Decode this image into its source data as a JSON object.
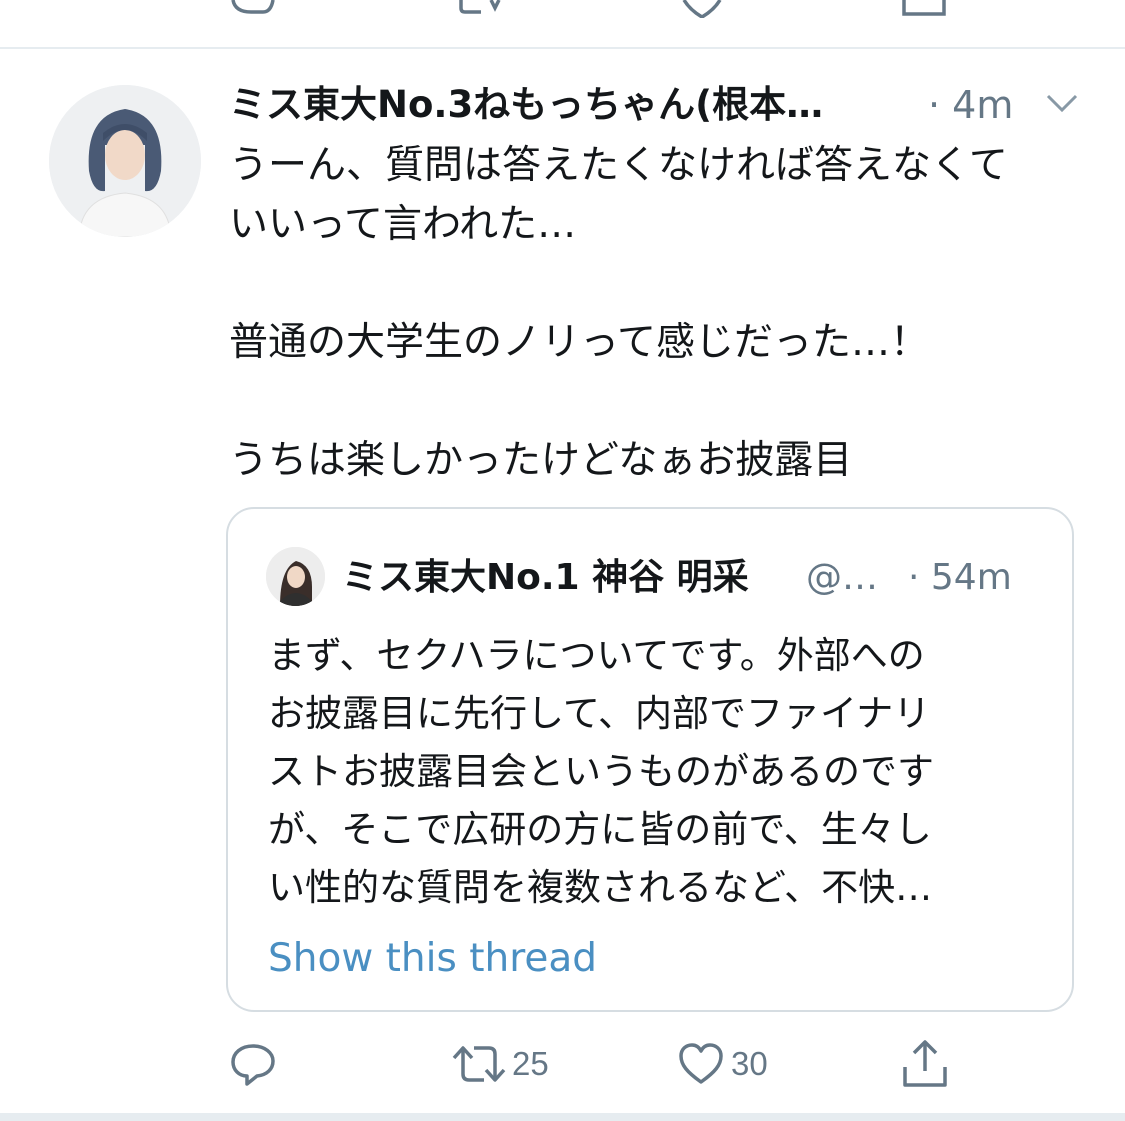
{
  "tweet": {
    "display_name": "ミス東大No.3ねもっちゃん(根本…",
    "time": "· 4m",
    "text_lines": [
      "うーん、質問は答えたくなければ答えなくて",
      "いいって言われた…",
      "",
      "普通の大学生のノリって感じだった…！",
      "",
      "うちは楽しかったけどなぁお披露目"
    ]
  },
  "quote": {
    "display_name": "ミス東大No.1 神谷 明采",
    "handle": "@…",
    "time": "· 54m",
    "text_lines": [
      "まず、セクハラについてです。外部への",
      "お披露目に先行して、内部でファイナリ",
      "ストお披露目会というものがあるのです",
      "が、そこで広研の方に皆の前で、生々し",
      "い性的な質問を複数されるなど、不快…"
    ],
    "show_thread": "Show this thread"
  },
  "actions": {
    "reply_icon": "reply-icon",
    "retweet_icon": "retweet-icon",
    "retweet_count": "25",
    "like_icon": "heart-icon",
    "like_count": "30",
    "share_icon": "share-icon"
  },
  "colors": {
    "text": "#14171a",
    "secondary": "#657786",
    "link": "#4a8fc2",
    "border": "#d6dde2"
  }
}
